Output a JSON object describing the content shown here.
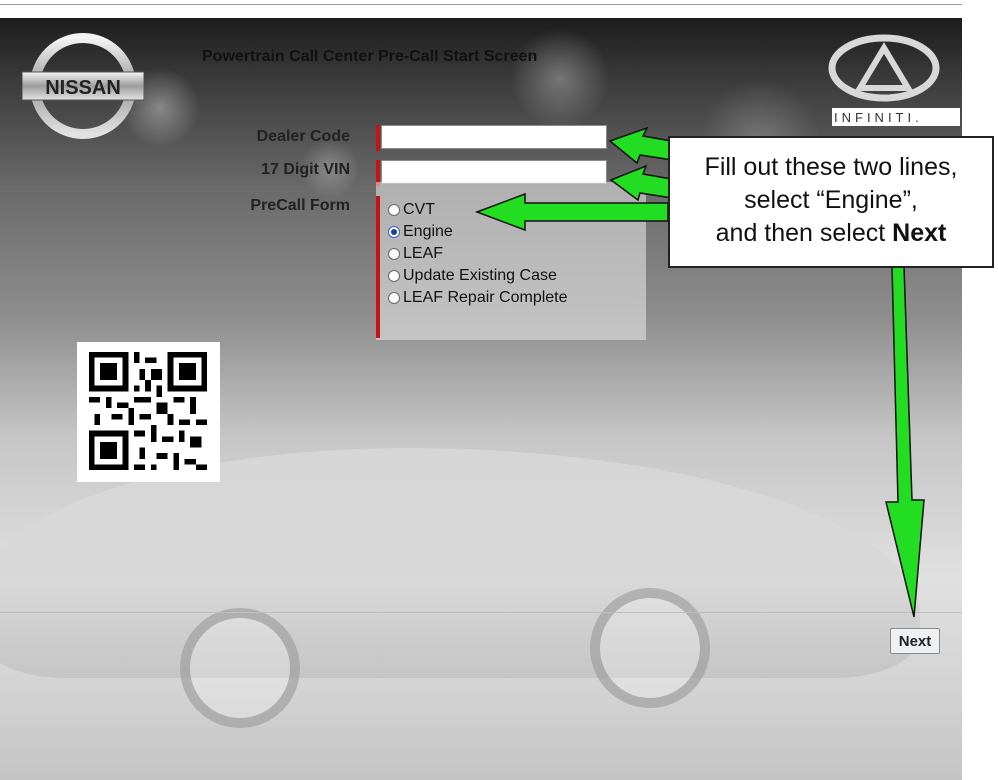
{
  "header": {
    "title": "Powertrain Call Center Pre-Call Start Screen",
    "nissan_logo_text": "NISSAN",
    "infiniti_logo_text": "INFINITI."
  },
  "form": {
    "dealer_code": {
      "label": "Dealer Code",
      "value": ""
    },
    "vin": {
      "label": "17 Digit VIN",
      "value": ""
    },
    "precall_form": {
      "label": "PreCall Form",
      "selected": "Engine",
      "options": [
        {
          "label": "CVT",
          "checked": false
        },
        {
          "label": "Engine",
          "checked": true
        },
        {
          "label": "LEAF",
          "checked": false
        },
        {
          "label": "Update Existing Case",
          "checked": false
        },
        {
          "label": "LEAF Repair Complete",
          "checked": false
        }
      ]
    }
  },
  "actions": {
    "next_label": "Next"
  },
  "callout": {
    "line1": "Fill out these two lines,",
    "line2": "select “Engine”,",
    "line3_prefix": "and then select ",
    "line3_bold": "Next"
  },
  "colors": {
    "arrow_fill": "#22dd22",
    "arrow_stroke": "#111111",
    "required_marker": "#c41515",
    "radio_checked": "#1d3d8f"
  }
}
